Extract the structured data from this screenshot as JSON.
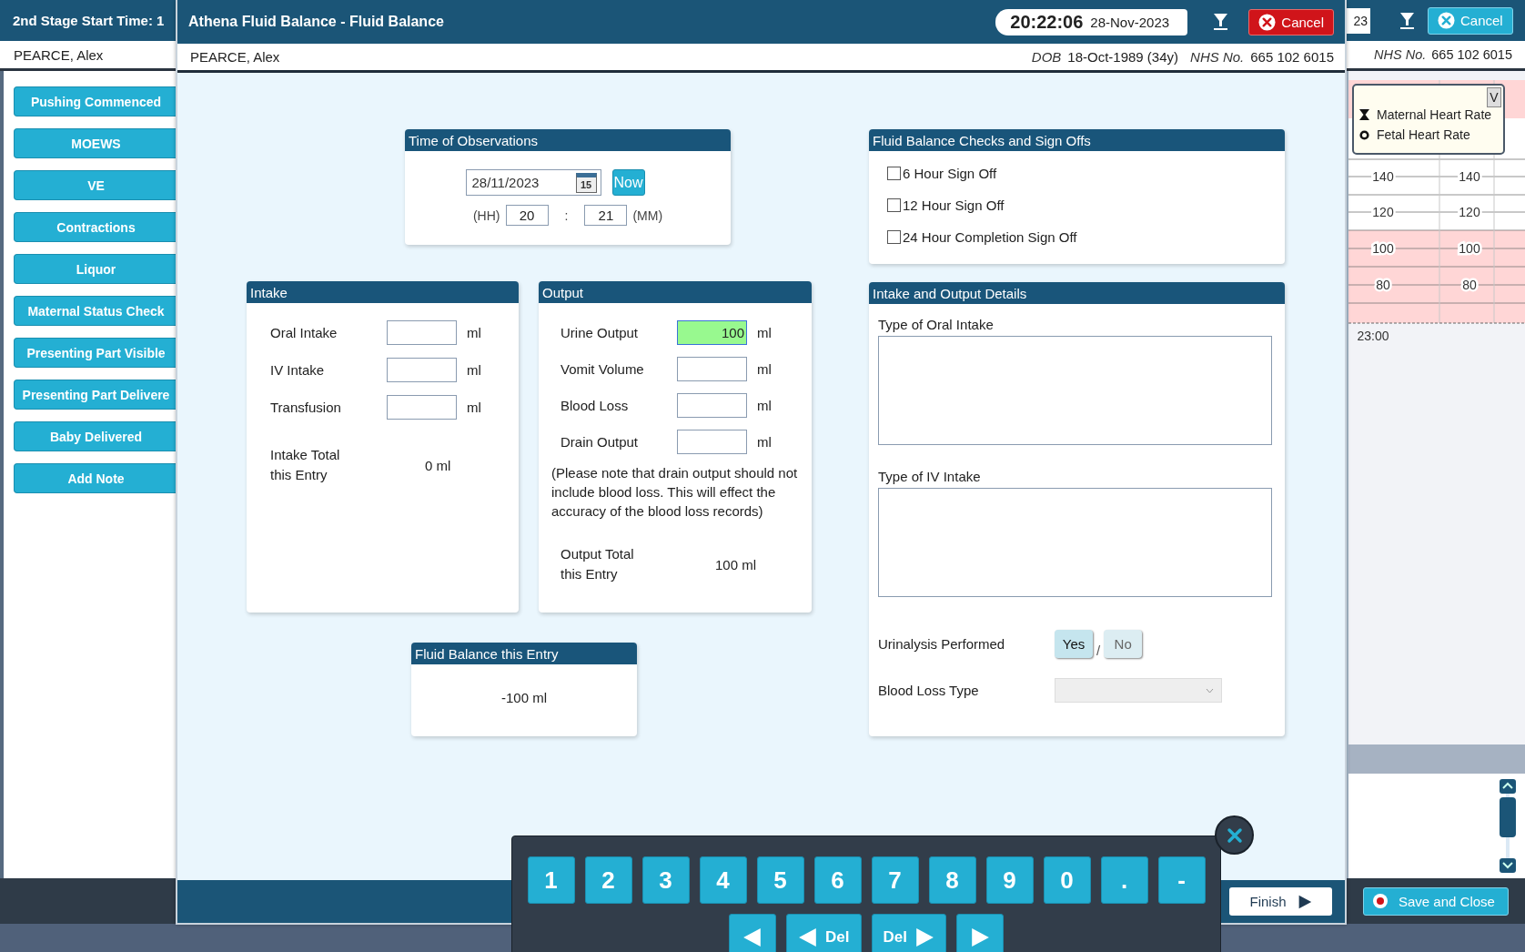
{
  "app": {
    "title": "2nd Stage Start Time: 1",
    "patient": "PEARCE, Alex",
    "actions": [
      "Pushing Commenced",
      "MOEWS",
      "VE",
      "Contractions",
      "Liquor",
      "Maternal Status Check",
      "Presenting Part Visible",
      "Presenting Part Delivere",
      "Baby Delivered",
      "Add Note"
    ],
    "time_fragment": "23",
    "cancel": "Cancel",
    "nhs_label": "NHS No.",
    "nhs_value": "665 102 6015",
    "chart": {
      "legend_toggle": "V",
      "legend": [
        {
          "label": "Maternal Heart Rate",
          "kind": "hourglass"
        },
        {
          "label": "Fetal Heart Rate",
          "kind": "ring"
        }
      ],
      "left_ticks": [
        "140",
        "120",
        "100",
        "80"
      ],
      "right_ticks": [
        "140",
        "120",
        "100",
        "80"
      ],
      "time_label": "23:00"
    },
    "save_close": "Save and Close"
  },
  "dialog": {
    "title": "Athena Fluid Balance - Fluid Balance",
    "clock_time": "20:22:06",
    "clock_date": "28-Nov-2023",
    "cancel": "Cancel",
    "patient": "PEARCE, Alex",
    "dob_label": "DOB",
    "dob_value": "18-Oct-1989 (34y)",
    "nhs_label": "NHS No.",
    "nhs_value": "665 102 6015",
    "time_panel": {
      "title": "Time of Observations",
      "date": "28/11/2023",
      "calendar_day": "15",
      "now": "Now",
      "hour_label": "(HH)",
      "hour": "20",
      "separator": ":",
      "minute": "21",
      "minute_label": "(MM)"
    },
    "intake": {
      "title": "Intake",
      "fields": [
        {
          "label": "Oral Intake",
          "unit": "ml",
          "highlighted": false
        },
        {
          "label": "IV Intake",
          "unit": "ml",
          "highlighted": false
        },
        {
          "label": "Transfusion",
          "unit": "ml",
          "highlighted": false
        }
      ],
      "total_label": "Intake Total this Entry",
      "total": "0 ml"
    },
    "output": {
      "title": "Output",
      "fields": [
        {
          "label": "Urine Output",
          "value": "100",
          "unit": "ml",
          "highlighted": true
        },
        {
          "label": "Vomit Volume",
          "unit": "ml",
          "highlighted": false
        },
        {
          "label": "Blood Loss",
          "unit": "ml",
          "highlighted": false
        },
        {
          "label": "Drain Output",
          "unit": "ml",
          "highlighted": false
        }
      ],
      "note": "(Please note that drain output should not include blood loss. This will effect the accuracy of the blood loss records)",
      "total_label": "Output Total this Entry",
      "total": "100 ml"
    },
    "balance": {
      "title": "Fluid Balance this Entry",
      "value": "-100 ml"
    },
    "checks": {
      "title": "Fluid Balance Checks and Sign Offs",
      "items": [
        {
          "label": "6 Hour Sign Off",
          "checked": false
        },
        {
          "label": "12 Hour Sign Off",
          "checked": false
        },
        {
          "label": "24 Hour Completion Sign Off",
          "checked": false
        }
      ]
    },
    "details": {
      "title": "Intake and Output Details",
      "oral_label": "Type of Oral Intake",
      "iv_label": "Type of IV Intake",
      "urinalysis_label": "Urinalysis Performed",
      "urinalysis_separator": "/",
      "urinalysis_options": [
        {
          "label": "Yes",
          "selected": true
        },
        {
          "label": "No",
          "selected": false
        }
      ],
      "blood_loss_label": "Blood Loss Type",
      "blood_loss_disabled": true
    },
    "finish": "Finish"
  },
  "keypad": {
    "keys": [
      "1",
      "2",
      "3",
      "4",
      "5",
      "6",
      "7",
      "8",
      "9",
      "0",
      ".",
      "-"
    ],
    "nav_keys": [
      {
        "kind": "left"
      },
      {
        "kind": "delete_left",
        "label": "Del"
      },
      {
        "kind": "delete_right",
        "label": "Del"
      },
      {
        "kind": "right"
      }
    ]
  }
}
